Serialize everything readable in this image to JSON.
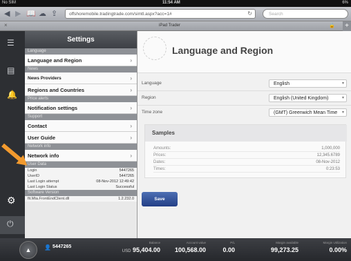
{
  "status": {
    "carrier": "No SIM",
    "time": "11:54 AM",
    "battery": "6%"
  },
  "browser": {
    "url": "offshoremobile.tradingtrade.com/simtl.aspx?acc=1#",
    "search_placeholder": "Search",
    "page_title": "iPad Trader"
  },
  "settings": {
    "title": "Settings",
    "sections": {
      "language": "Language",
      "news": "News",
      "price_alerts": "Price alerts",
      "support": "Support",
      "network_info": "Network info",
      "user_data": "User Data",
      "software_version": "Software Version"
    },
    "items": {
      "language_region": "Language and Region",
      "news_providers": "News Providers",
      "regions_countries": "Regions and Countries",
      "notification_settings": "Notification settings",
      "contact": "Contact",
      "user_guide": "User Guide",
      "network_info": "Network info"
    },
    "user_data": {
      "login_label": "Login",
      "login_value": "5447265",
      "userid_label": "UserID",
      "userid_value": "5447265",
      "last_login_label": "Last Login attempt",
      "last_login_value": "08-Nov-2012 12:49:42",
      "last_login_status_label": "Last Login Status",
      "last_login_status_value": "Successful"
    },
    "version_label": "fit.Mta.FrontEndClient.dll",
    "version_value": "1.2.232.0"
  },
  "main": {
    "title": "Language and Region",
    "language_label": "Language",
    "language_value": "English",
    "region_label": "Region",
    "region_value": "English (United Kingdom)",
    "timezone_label": "Time zone",
    "timezone_value": "(GMT) Greenwich Mean Time",
    "samples_title": "Samples",
    "samples": [
      {
        "label": "Amounts:",
        "value": "1,000,000"
      },
      {
        "label": "Prices:",
        "value": "12,345.6789"
      },
      {
        "label": "Dates:",
        "value": "08-Nov-2012"
      },
      {
        "label": "Times:",
        "value": "0:23:53"
      }
    ],
    "save_label": "Save"
  },
  "account_bar": {
    "user": "5447265",
    "balance_label": "Balance",
    "balance_currency": "USD",
    "balance_value": "95,404.00",
    "account_value_label": "Account value",
    "account_value": "100,568.00",
    "pl_label": "P/L",
    "pl_value": "0.00",
    "margin_available_label": "Margin available",
    "margin_available_value": "99,273.25",
    "margin_utilization_label": "Margin Utilization",
    "margin_utilization_value": "0.00%"
  },
  "colors": {
    "accent_arrow": "#f29a2e",
    "save_button": "#2d4b91",
    "panel_dark": "#2d2f33"
  }
}
